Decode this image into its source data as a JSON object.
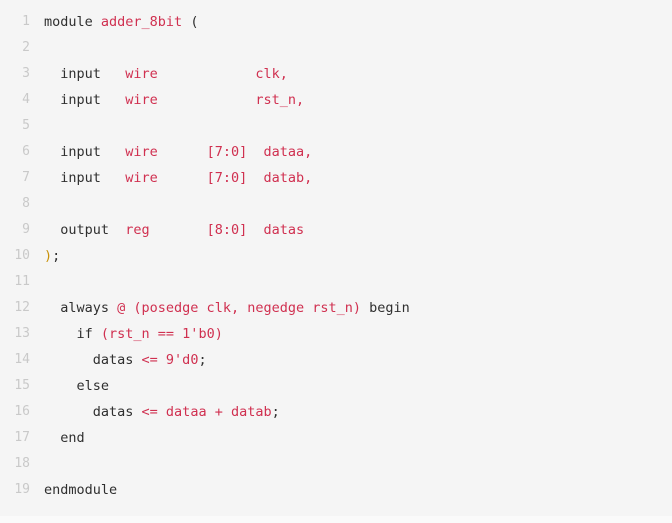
{
  "editor": {
    "language": "verilog",
    "background_color": "#f5f5f5",
    "gutter_color": "#c9c9c9",
    "keyword_color": "#2f2f2f",
    "identifier_color": "#d03050",
    "bracket_color": "#c9920a",
    "line_count": 19
  },
  "lines": [
    {
      "number": "1",
      "text": "module adder_8bit (",
      "tokens": [
        {
          "t": "module ",
          "c": "tok-dark"
        },
        {
          "t": "adder_8bit",
          "c": "tok-red"
        },
        {
          "t": " ",
          "c": "tok-dark"
        },
        {
          "t": "(",
          "c": "tok-dark"
        }
      ]
    },
    {
      "number": "2",
      "text": "",
      "tokens": []
    },
    {
      "number": "3",
      "text": "  input   wire            clk,",
      "tokens": [
        {
          "t": "  input   ",
          "c": "tok-dark"
        },
        {
          "t": "wire",
          "c": "tok-red"
        },
        {
          "t": "            ",
          "c": "tok-dark"
        },
        {
          "t": "clk,",
          "c": "tok-red"
        }
      ]
    },
    {
      "number": "4",
      "text": "  input   wire            rst_n,",
      "tokens": [
        {
          "t": "  input   ",
          "c": "tok-dark"
        },
        {
          "t": "wire",
          "c": "tok-red"
        },
        {
          "t": "            ",
          "c": "tok-dark"
        },
        {
          "t": "rst_n,",
          "c": "tok-red"
        }
      ]
    },
    {
      "number": "5",
      "text": "",
      "tokens": []
    },
    {
      "number": "6",
      "text": "  input   wire      [7:0]  dataa,",
      "tokens": [
        {
          "t": "  input   ",
          "c": "tok-dark"
        },
        {
          "t": "wire",
          "c": "tok-red"
        },
        {
          "t": "      ",
          "c": "tok-dark"
        },
        {
          "t": "[7:0]",
          "c": "tok-red"
        },
        {
          "t": "  ",
          "c": "tok-dark"
        },
        {
          "t": "dataa,",
          "c": "tok-red"
        }
      ]
    },
    {
      "number": "7",
      "text": "  input   wire      [7:0]  datab,",
      "tokens": [
        {
          "t": "  input   ",
          "c": "tok-dark"
        },
        {
          "t": "wire",
          "c": "tok-red"
        },
        {
          "t": "      ",
          "c": "tok-dark"
        },
        {
          "t": "[7:0]",
          "c": "tok-red"
        },
        {
          "t": "  ",
          "c": "tok-dark"
        },
        {
          "t": "datab,",
          "c": "tok-red"
        }
      ]
    },
    {
      "number": "8",
      "text": "",
      "tokens": []
    },
    {
      "number": "9",
      "text": "  output  reg       [8:0]  datas",
      "tokens": [
        {
          "t": "  output  ",
          "c": "tok-dark"
        },
        {
          "t": "reg",
          "c": "tok-red"
        },
        {
          "t": "       ",
          "c": "tok-dark"
        },
        {
          "t": "[8:0]",
          "c": "tok-red"
        },
        {
          "t": "  ",
          "c": "tok-dark"
        },
        {
          "t": "datas",
          "c": "tok-red"
        }
      ]
    },
    {
      "number": "10",
      "text": ");",
      "tokens": [
        {
          "t": ")",
          "c": "tok-amber"
        },
        {
          "t": ";",
          "c": "tok-dark"
        }
      ]
    },
    {
      "number": "11",
      "text": "",
      "tokens": []
    },
    {
      "number": "12",
      "text": "  always @ (posedge clk, negedge rst_n) begin",
      "tokens": [
        {
          "t": "  always ",
          "c": "tok-dark"
        },
        {
          "t": "@ (posedge clk, negedge rst_n)",
          "c": "tok-red"
        },
        {
          "t": " begin",
          "c": "tok-dark"
        }
      ]
    },
    {
      "number": "13",
      "text": "    if (rst_n == 1'b0)",
      "tokens": [
        {
          "t": "    if ",
          "c": "tok-dark"
        },
        {
          "t": "(rst_n == 1'b0)",
          "c": "tok-red"
        }
      ]
    },
    {
      "number": "14",
      "text": "      datas <= 9'd0;",
      "tokens": [
        {
          "t": "      datas ",
          "c": "tok-dark"
        },
        {
          "t": "<= 9'd0",
          "c": "tok-red"
        },
        {
          "t": ";",
          "c": "tok-dark"
        }
      ]
    },
    {
      "number": "15",
      "text": "    else",
      "tokens": [
        {
          "t": "    else",
          "c": "tok-dark"
        }
      ]
    },
    {
      "number": "16",
      "text": "      datas <= dataa + datab;",
      "tokens": [
        {
          "t": "      datas ",
          "c": "tok-dark"
        },
        {
          "t": "<= dataa + datab",
          "c": "tok-red"
        },
        {
          "t": ";",
          "c": "tok-dark"
        }
      ]
    },
    {
      "number": "17",
      "text": "  end",
      "tokens": [
        {
          "t": "  end",
          "c": "tok-dark"
        }
      ]
    },
    {
      "number": "18",
      "text": "",
      "tokens": []
    },
    {
      "number": "19",
      "text": "endmodule",
      "tokens": [
        {
          "t": "endmodule",
          "c": "tok-dark"
        }
      ]
    }
  ]
}
